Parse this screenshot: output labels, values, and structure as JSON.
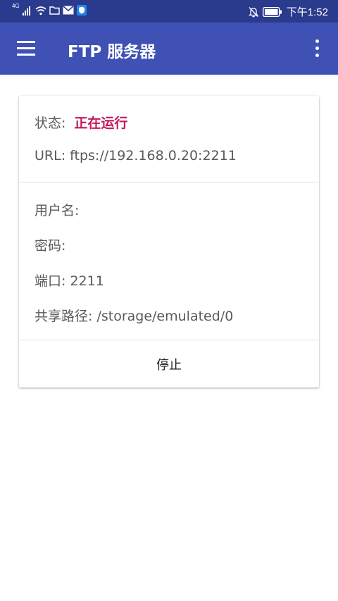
{
  "status_bar": {
    "network": "4G",
    "time": "下午1:52"
  },
  "app_bar": {
    "title": "FTP 服务器"
  },
  "server_card": {
    "status_label": "状态:",
    "status_value": "正在运行",
    "url_label": "URL:",
    "url_value": "ftps://192.168.0.20:2211",
    "username_label": "用户名:",
    "username_value": "",
    "password_label": "密码:",
    "password_value": "",
    "port_label": "端口:",
    "port_value": "2211",
    "share_path_label": "共享路径:",
    "share_path_value": "/storage/emulated/0",
    "stop_button_label": "停止"
  },
  "colors": {
    "status_bar": "#2a3a8c",
    "app_bar": "#3f51b5",
    "status_running": "#c2185b"
  }
}
